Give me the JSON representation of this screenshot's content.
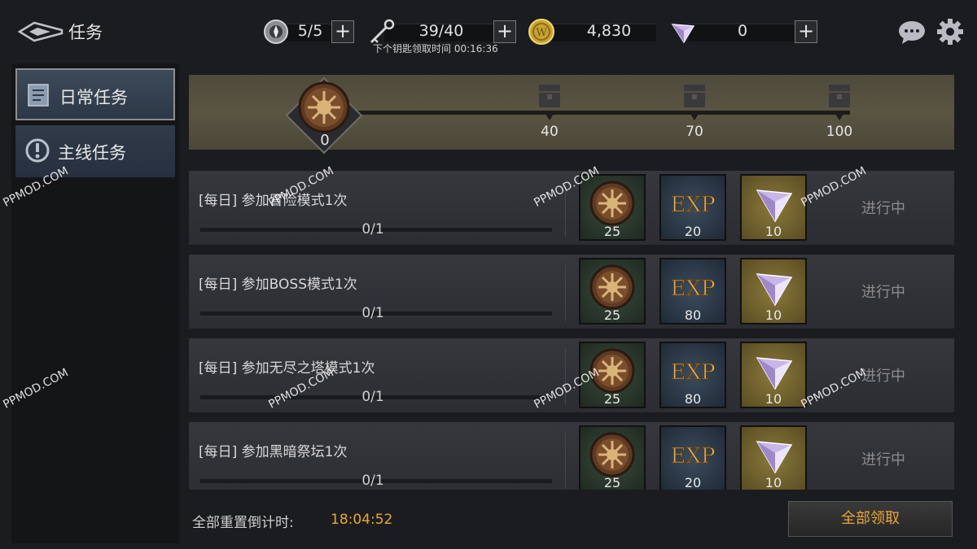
{
  "header": {
    "title": "任务",
    "resources": [
      {
        "name": "stamina",
        "icon": "compass-icon",
        "value": "5/5"
      },
      {
        "name": "keys",
        "icon": "key-icon",
        "value": "39/40",
        "note": "下个钥匙领取时间 00:16:36"
      },
      {
        "name": "gold",
        "icon": "gold-coin-icon",
        "value": "4,830"
      },
      {
        "name": "gems",
        "icon": "diamond-icon",
        "value": "0"
      }
    ],
    "plus_symbol": "+"
  },
  "sidebar": {
    "tabs": [
      {
        "label": "日常任务",
        "icon": "scroll-icon",
        "active": true
      },
      {
        "label": "主线任务",
        "icon": "exclamation-icon",
        "active": false
      }
    ]
  },
  "progress": {
    "current": "0",
    "milestones": [
      "40",
      "70",
      "100"
    ]
  },
  "quests": [
    {
      "name": "[每日] 参加冒险模式1次",
      "progress": "0/1",
      "rewards": [
        "25",
        "20",
        "10"
      ],
      "status": "进行中"
    },
    {
      "name": "[每日] 参加BOSS模式1次",
      "progress": "0/1",
      "rewards": [
        "25",
        "80",
        "10"
      ],
      "status": "进行中"
    },
    {
      "name": "[每日] 参加无尽之塔模式1次",
      "progress": "0/1",
      "rewards": [
        "25",
        "80",
        "10"
      ],
      "status": "进行中"
    },
    {
      "name": "[每日] 参加黑暗祭坛1次",
      "progress": "0/1",
      "rewards": [
        "25",
        "20",
        "10"
      ],
      "status": "进行中"
    }
  ],
  "footer": {
    "reset_label": "全部重置倒计时:",
    "reset_time": "18:04:52",
    "claim_all": "全部领取"
  },
  "watermark": "PPMOD.COM",
  "colors": {
    "accent": "#e8a63a",
    "status": "#8c8c8c"
  }
}
